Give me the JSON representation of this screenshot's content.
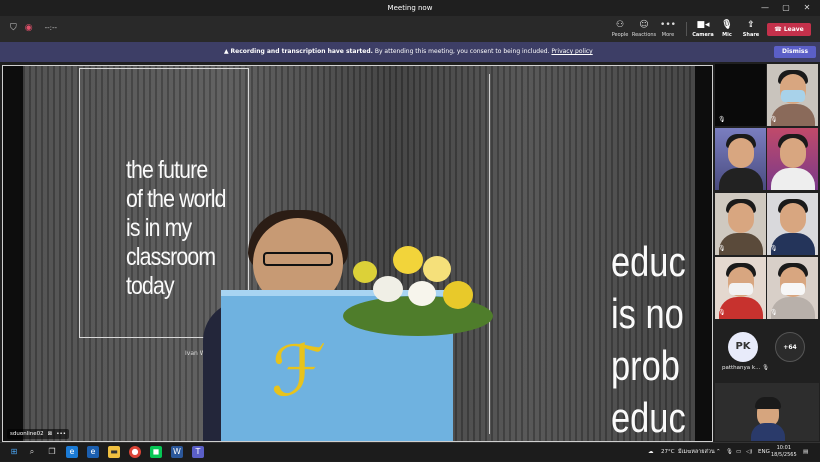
{
  "window": {
    "title": "Meeting now",
    "minimize": "—",
    "maximize": "▢",
    "close": "✕"
  },
  "toolbar": {
    "timer": "--:--",
    "people_label": "People",
    "reactions_label": "Reactions",
    "more_label": "More",
    "camera_label": "Camera",
    "mic_label": "Mic",
    "share_label": "Share",
    "leave_label": "Leave"
  },
  "banner": {
    "bold": "Recording and transcription have started.",
    "text": "By attending this meeting, you consent to being included.",
    "link": "Privacy policy",
    "dismiss_label": "Dismiss"
  },
  "stage": {
    "wall_left": "the future\nof the world\nis in my\nclassroom\ntoday",
    "wall_right": "educ\nis no\nprob\neduc",
    "wall_small": "Ivan W...",
    "speaker_name": "sduonline02"
  },
  "gallery": {
    "avatar_initials": "PK",
    "avatar_name": "patthanya k...",
    "overflow": "+64"
  },
  "taskbar": {
    "weather": "27°C",
    "weather_desc": "มีเมฆหลายส่วน",
    "lang": "ENG",
    "time": "10:01",
    "date": "18/5/2565"
  },
  "colors": {
    "accent": "#5b5fc7",
    "leave": "#c4314b",
    "banner": "#3d3e66"
  }
}
